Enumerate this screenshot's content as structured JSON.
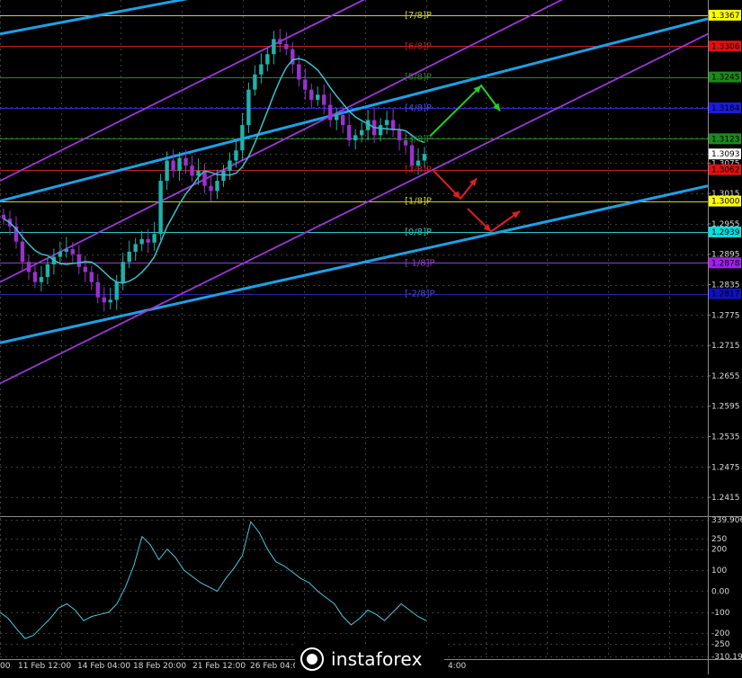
{
  "colors": {
    "background": "#000000",
    "grid": "#3c3c3c",
    "bull_candle": "#20b2aa",
    "bear_candle": "#9932cc",
    "trend_line": "#1ea0e6",
    "channel_line": "#9b38d8",
    "moving_average": "#3fc0c8",
    "cci_line": "#48c8dc",
    "axis_text": "#d8d8d8",
    "up_arrow": "#22d022",
    "down_arrow": "#e02020"
  },
  "watermark": {
    "text": "instaforex"
  },
  "chart_data": [
    {
      "type": "candlestick",
      "symbol": "GBP/USD",
      "ylim": [
        1.2385,
        1.3397
      ],
      "y_ticks": [
        "1.3367",
        "1.3245",
        "1.3185",
        "1.3125",
        "1.3093",
        "1.3075",
        "1.3015",
        "1.2955",
        "1.2895",
        "1.2835",
        "1.2775",
        "1.2715",
        "1.2655",
        "1.2595",
        "1.2535",
        "1.2475",
        "1.2415"
      ],
      "x_ticks": [
        "11 Feb 12:00",
        "14 Feb 04:00",
        "18 Feb 20:00",
        "21 Feb 12:00",
        "26 Feb 04:00",
        "4:00"
      ],
      "current_price": "1.3093",
      "close_path": [
        1.2965,
        1.295,
        1.292,
        1.288,
        1.286,
        1.284,
        1.285,
        1.2875,
        1.289,
        1.29,
        1.2905,
        1.2895,
        1.287,
        1.286,
        1.284,
        1.281,
        1.28,
        1.2805,
        1.284,
        1.288,
        1.29,
        1.2915,
        1.2925,
        1.2918,
        1.2935,
        1.304,
        1.308,
        1.306,
        1.3085,
        1.307,
        1.305,
        1.306,
        1.303,
        1.302,
        1.304,
        1.306,
        1.308,
        1.31,
        1.315,
        1.322,
        1.325,
        1.327,
        1.329,
        1.332,
        1.331,
        1.33,
        1.327,
        1.324,
        1.322,
        1.32,
        1.321,
        1.319,
        1.316,
        1.317,
        1.315,
        1.312,
        1.313,
        1.314,
        1.316,
        1.313,
        1.315,
        1.316,
        1.314,
        1.312,
        1.311,
        1.307,
        1.308,
        1.3093
      ],
      "murrey_levels": [
        {
          "label": "[7/8]P",
          "price": 1.3367,
          "price_label": "1.3367",
          "color": "#d2d22a",
          "label_bg": "#ffff00",
          "text": "#000000"
        },
        {
          "label": "[6/8]P",
          "price": 1.3306,
          "price_label": "1.3306",
          "color": "#c82020",
          "label_bg": "#e01010",
          "text": "#000000"
        },
        {
          "label": "[5/8]P",
          "price": 1.3245,
          "price_label": "1.3245",
          "color": "#1f8a1f",
          "label_bg": "#1c8a1c",
          "text": "#000000"
        },
        {
          "label": "[4/8]P",
          "price": 1.3184,
          "price_label": "1.3184",
          "color": "#2b2bd0",
          "label_bg": "#1a1ae0",
          "text": "#000000"
        },
        {
          "label": "[3/8]P",
          "price": 1.3123,
          "price_label": "1.3123",
          "color": "#1f8a1f",
          "label_bg": "#1c8a1c",
          "text": "#000000"
        },
        {
          "label": "[2/8]P",
          "price": 1.3062,
          "price_label": "1.3062",
          "color": "#c82020",
          "label_bg": "#e01010",
          "text": "#000000"
        },
        {
          "label": "[1/8]P",
          "price": 1.3,
          "price_label": "1.3000",
          "color": "#d2d22a",
          "label_bg": "#ffff00",
          "text": "#000000"
        },
        {
          "label": "[0/8]P",
          "price": 1.2939,
          "price_label": "1.2939",
          "color": "#28c8c8",
          "label_bg": "#00e0e0",
          "text": "#000000"
        },
        {
          "label": "[-1/8]P",
          "price": 1.2878,
          "price_label": "1.2878",
          "color": "#9a3ad0",
          "label_bg": "#a020f0",
          "text": "#000000"
        },
        {
          "label": "[-2/8]P",
          "price": 1.2817,
          "price_label": "1.2817",
          "color": "#2222a8",
          "label_bg": "#1010c0",
          "text": "#000000"
        }
      ],
      "last_price_label": "1.3093"
    },
    {
      "type": "line",
      "indicator": "CCI",
      "ylim": [
        -310.194,
        339.9066
      ],
      "y_ticks": [
        "339.9066",
        "250",
        "200",
        "100",
        "0.00",
        "-100",
        "-200",
        "-250",
        "-310.194"
      ],
      "values": [
        -100,
        -130,
        -180,
        -225,
        -210,
        -170,
        -130,
        -80,
        -60,
        -90,
        -140,
        -120,
        -110,
        -100,
        -60,
        20,
        120,
        260,
        220,
        150,
        200,
        160,
        100,
        70,
        40,
        20,
        0,
        60,
        110,
        170,
        330,
        280,
        200,
        140,
        120,
        90,
        60,
        40,
        0,
        -30,
        -60,
        -120,
        -160,
        -130,
        -90,
        -110,
        -140,
        -100,
        -60,
        -90,
        -120,
        -140
      ]
    }
  ]
}
